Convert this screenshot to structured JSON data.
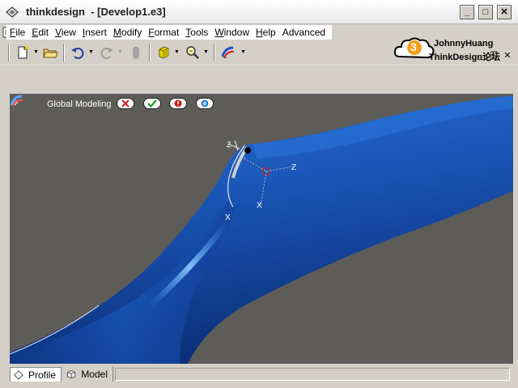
{
  "window": {
    "app_name": "thinkdesign",
    "document": "- [Develop1.e3]",
    "minimize_glyph": "_",
    "maximize_glyph": "□",
    "close_glyph": "✕"
  },
  "menu": {
    "items": [
      {
        "label": "File",
        "key": "F",
        "rest": "ile"
      },
      {
        "label": "Edit",
        "key": "E",
        "rest": "dit"
      },
      {
        "label": "View",
        "key": "V",
        "rest": "iew"
      },
      {
        "label": "Insert",
        "key": "I",
        "rest": "nsert"
      },
      {
        "label": "Modify",
        "key": "M",
        "rest": "odify"
      },
      {
        "label": "Format",
        "key": "F",
        "rest": "ormat"
      },
      {
        "label": "Tools",
        "key": "T",
        "rest": "ools"
      },
      {
        "label": "Window",
        "key": "W",
        "rest": "indow"
      },
      {
        "label": "Help",
        "key": "H",
        "rest": "elp"
      },
      {
        "label": "Advanced",
        "key": "",
        "rest": "Advanced"
      }
    ],
    "mdi_minimize_glyph": "_",
    "mdi_restore_glyph": "❐",
    "mdi_close_glyph": "✕"
  },
  "toolbar": {
    "buttons": [
      {
        "name": "new-document-icon",
        "has_dropdown": true
      },
      {
        "name": "open-folder-icon",
        "has_dropdown": false
      },
      {
        "name": "undo-icon",
        "has_dropdown": true
      },
      {
        "name": "redo-icon",
        "has_dropdown": true,
        "disabled": true
      },
      {
        "name": "erase-icon",
        "disabled": true
      },
      {
        "name": "solid-cube-icon",
        "has_dropdown": true
      },
      {
        "name": "zoom-magnifier-icon",
        "has_dropdown": true
      },
      {
        "name": "global-modeling-icon",
        "has_dropdown": true
      }
    ]
  },
  "watermark": {
    "badge_number": "3",
    "line1": "JohnnyHuang",
    "line2": "ThinkDesign论坛"
  },
  "viewport": {
    "toolbar_label": "Global Modeling",
    "expand_glyph": "+",
    "actions": [
      {
        "name": "cancel-icon"
      },
      {
        "name": "confirm-check-icon"
      },
      {
        "name": "warning-exclaim-icon"
      },
      {
        "name": "preview-magnifier-icon"
      }
    ],
    "marker_labels": {
      "m1": "Z",
      "m2": "X",
      "m3": "X",
      "m4": "Z"
    },
    "colors": {
      "background": "#5e5c58",
      "surface": "#1a56b8",
      "highlight": "#8ecbff"
    }
  },
  "tabs": [
    {
      "label": "Profile",
      "active": true
    },
    {
      "label": "Model",
      "active": false
    }
  ]
}
